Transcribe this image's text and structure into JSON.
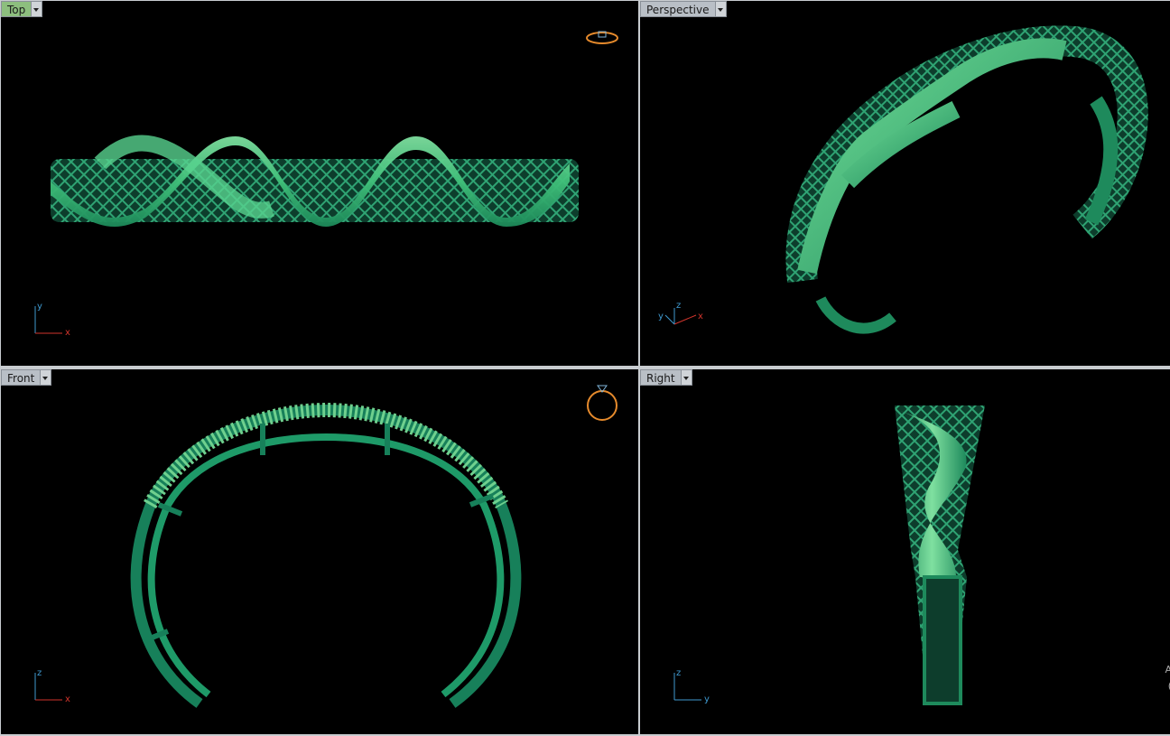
{
  "viewports": {
    "top": {
      "label": "Top",
      "axes": {
        "a": "y",
        "b": "x"
      },
      "active": true
    },
    "perspective": {
      "label": "Perspective",
      "axes": {
        "a": "z",
        "b": "y",
        "c": "x"
      }
    },
    "front": {
      "label": "Front",
      "axes": {
        "a": "z",
        "b": "x"
      }
    },
    "right": {
      "label": "Right",
      "axes": {
        "a": "z",
        "b": "y"
      },
      "edge_text_1": "A",
      "edge_text_2": "("
    }
  },
  "colors": {
    "viewport_bg": "#000000",
    "model_green": "#3fc07a",
    "model_dark": "#17805a",
    "active_tab": "#8dbf7e",
    "axis_x": "#d0342c",
    "axis_y": "#3f9ad1",
    "axis_z": "#3f9ad1"
  },
  "icons": [
    "viewport-menu-arrow-icon",
    "ring-view-icon",
    "axis-gizmo-icon"
  ]
}
